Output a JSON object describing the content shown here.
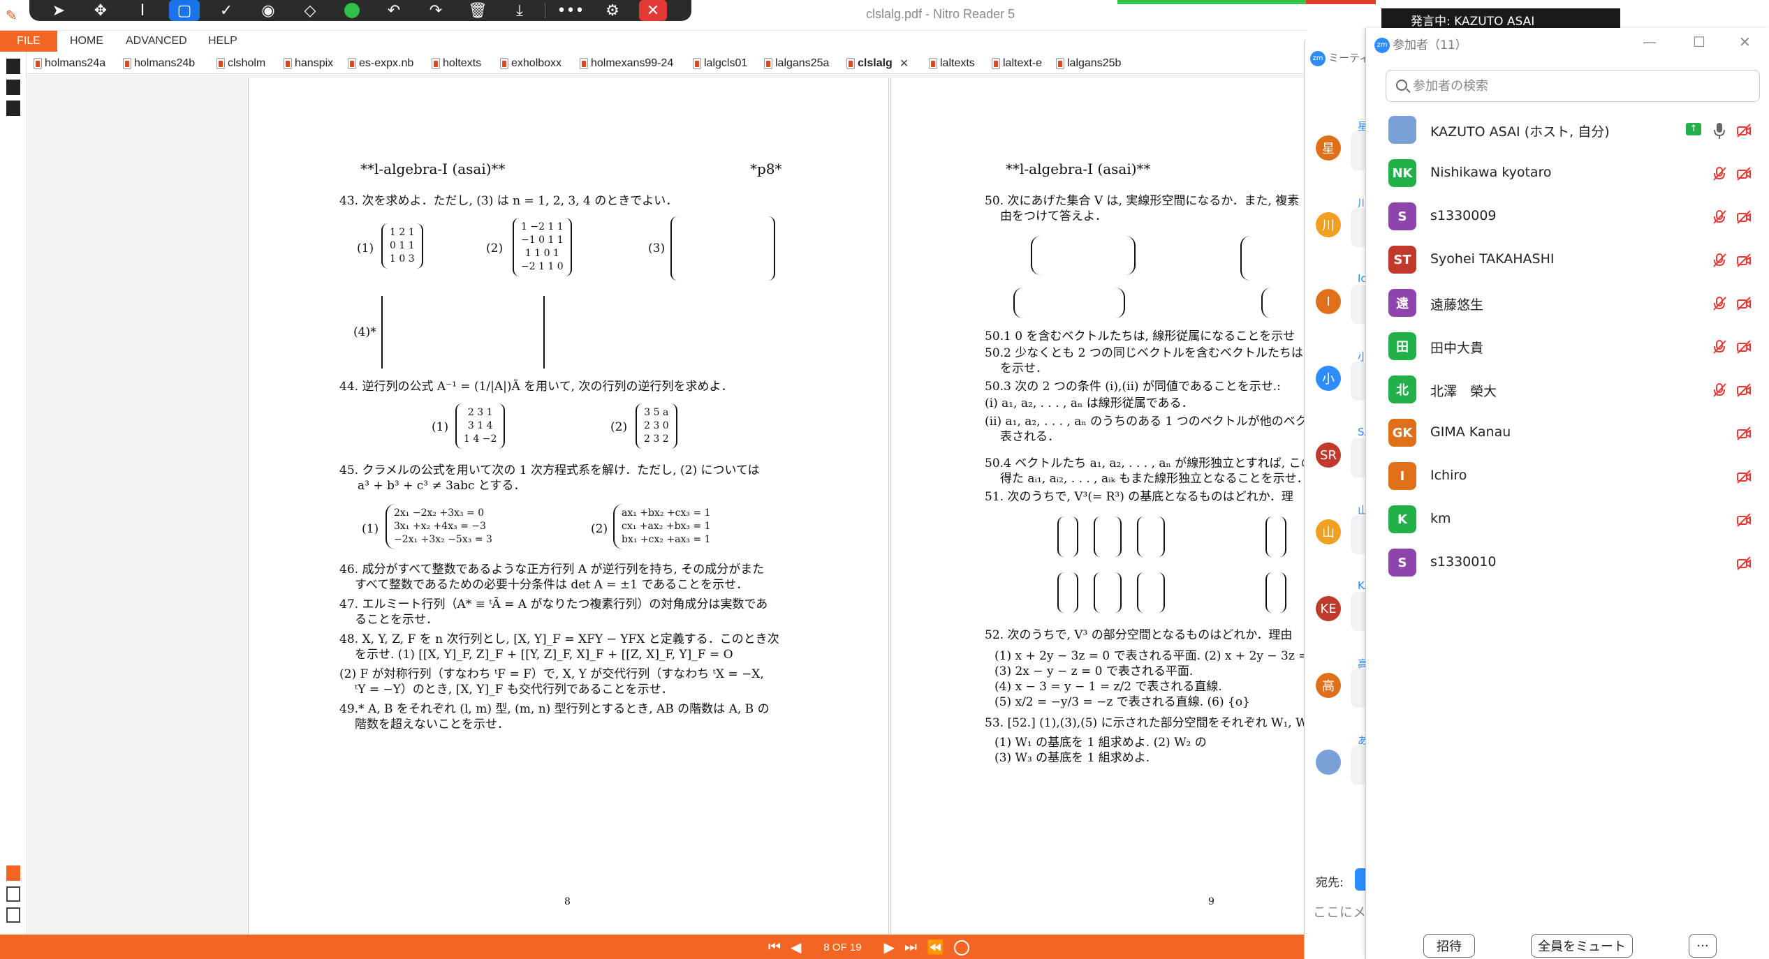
{
  "app": {
    "title": "clslalg.pdf - Nitro Reader 5",
    "menu": [
      "FILE",
      "HOME",
      "ADVANCED",
      "HELP"
    ]
  },
  "tabs": [
    {
      "label": "holmans24a"
    },
    {
      "label": "holmans24b"
    },
    {
      "label": "clsholm"
    },
    {
      "label": "hanspix"
    },
    {
      "label": "es-expx.nb"
    },
    {
      "label": "holtexts"
    },
    {
      "label": "exholboxx"
    },
    {
      "label": "holmexans99-24"
    },
    {
      "label": "lalgcls01"
    },
    {
      "label": "lalgans25a"
    },
    {
      "label": "clslalg",
      "active": true
    },
    {
      "label": "laltexts"
    },
    {
      "label": "laltext-e"
    },
    {
      "label": "lalgans25b"
    }
  ],
  "pages": {
    "left": {
      "header_left": "**l-algebra-I (asai)**",
      "header_right": "*p8*",
      "lines": [
        "43. 次を求めよ．ただし, (3) は n = 1, 2, 3, 4 のときでよい．",
        "44. 逆行列の公式 A⁻¹ = (1/|A|)Ã を用いて, 次の行列の逆行列を求めよ．",
        "45. クラメルの公式を用いて次の 1 次方程式系を解け．ただし, (2) については",
        "a³ + b³ + c³ ≠ 3abc とする．",
        "46. 成分がすべて整数であるような正方行列 A が逆行列を持ち, その成分がまた",
        "すべて整数であるための必要十分条件は det A = ±1 であることを示せ．",
        "47. エルミート行列（A* ≡ ᵗĀ = A がなりたつ複素行列）の対角成分は実数であ",
        "ることを示せ．",
        "48. X, Y, Z, F を n 次行列とし, [X, Y]_F = XFY − YFX と定義する．このとき次",
        "を示せ. (1) [[X, Y]_F, Z]_F + [[Y, Z]_F, X]_F + [[Z, X]_F, Y]_F = O",
        "(2) F が対称行列（すなわち ᵗF = F）で, X, Y が交代行列（すなわち ᵗX = −X,",
        "ᵗY = −Y）のとき, [X, Y]_F も交代行列であることを示せ．",
        "49.* A, B をそれぞれ (l, m) 型, (m, n) 型行列とするとき, AB の階数は A, B の",
        "階数を超えないことを示せ．"
      ],
      "matrices": {
        "q43_1": [
          "1 2 1",
          "0 1 1",
          "1 0 3"
        ],
        "q43_2": [
          "1 −2 1 1",
          "−1 0 1 1",
          "1 1 0 1",
          "−2 1 1 0"
        ],
        "q44_1": [
          "2 3 1",
          "3 1 4",
          "1 4 −2"
        ],
        "q44_2": [
          "3 5 a",
          "2 3 0",
          "2 3 2"
        ],
        "q45_1": [
          "2x₁ −2x₂ +3x₃ = 0",
          "3x₁ +x₂ +4x₃ = −3",
          "−2x₁ +3x₂ −5x₃ = 3"
        ],
        "q45_2": [
          "ax₁ +bx₂ +cx₃ = 1",
          "cx₁ +ax₂ +bx₃ = 1",
          "bx₁ +cx₂ +ax₃ = 1"
        ]
      },
      "page_number": "8"
    },
    "right": {
      "header_left": "**l-algebra-I (asai)**",
      "lines": [
        "50. 次にあげた集合 V は, 実線形空間になるか．また, 複素",
        "由をつけて答えよ．",
        "50.1 0 を含むベクトルたちは, 線形従属になることを示せ",
        "50.2 少なくとも 2 つの同じベクトルを含むベクトルたちは",
        "を示せ．",
        "50.3 次の 2 つの条件 (i),(ii) が同値であることを示せ.:",
        "(i) a₁, a₂, . . . , aₙ は線形従属である．",
        "(ii) a₁, a₂, . . . , aₙ のうちのある 1 つのベクトルが他のベク",
        "表される．",
        "50.4 ベクトルたち a₁, a₂, . . . , aₙ が線形独立とすれば, この",
        "得た aᵢ₁, aᵢ₂, . . . , aᵢₖ もまた線形独立となることを示せ．",
        "51. 次のうちで, V³(= R³) の基底となるものはどれか．理",
        "52. 次のうちで, V³ の部分空間となるものはどれか．理由",
        "(1) x + 2y − 3z = 0 で表される平面.  (2) x + 2y − 3z =",
        "(3) 2x − y − z = 0 で表される平面.",
        "(4) x − 3 = y − 1 = z/2 で表される直線.",
        "(5) x/2 = −y/3 = −z で表される直線.       (6) {o}",
        "53. [52.] (1),(3),(5) に示された部分空間をそれぞれ W₁, W",
        "(1) W₁ の基底を 1 組求めよ.                    (2) W₂ の",
        "(3) W₃ の基底を 1 組求めよ."
      ],
      "page_number": "9"
    }
  },
  "statusbar": {
    "page_indicator": "8 OF 19"
  },
  "chat": {
    "title": "ミーティ",
    "to_label": "宛先:",
    "input_placeholder": "ここにメッ",
    "avatars": [
      "星",
      "川",
      "I",
      "小",
      "SR",
      "山",
      "KE",
      "高"
    ],
    "names": [
      "星",
      "川",
      "Ic",
      "小",
      "SA",
      "山",
      "KA",
      "高",
      "あ"
    ]
  },
  "speaking": {
    "label": "発言中: KAZUTO ASAI"
  },
  "participants": {
    "title": "参加者（11）",
    "search_placeholder": "参加者の検索",
    "list": [
      {
        "initials": "",
        "name": "KAZUTO ASAI (ホスト, 自分)",
        "color": "#7aa0d8",
        "host": true
      },
      {
        "initials": "NK",
        "name": "Nishikawa kyotaro",
        "color": "#23b04b"
      },
      {
        "initials": "S",
        "name": "s1330009",
        "color": "#8e44ad"
      },
      {
        "initials": "ST",
        "name": "Syohei TAKAHASHI",
        "color": "#c0392b"
      },
      {
        "initials": "遠",
        "name": "遠藤悠生",
        "color": "#8e44ad"
      },
      {
        "initials": "田",
        "name": "田中大貴",
        "color": "#23b04b"
      },
      {
        "initials": "北",
        "name": "北澤　榮大",
        "color": "#23b04b"
      },
      {
        "initials": "GK",
        "name": "GIMA Kanau",
        "color": "#e06f1a"
      },
      {
        "initials": "I",
        "name": "Ichiro",
        "color": "#e06f1a"
      },
      {
        "initials": "K",
        "name": "km",
        "color": "#23b04b"
      },
      {
        "initials": "S",
        "name": "s1330010",
        "color": "#8e44ad"
      }
    ],
    "buttons": {
      "invite": "招待",
      "mute_all": "全員をミュート",
      "more": "···"
    }
  }
}
